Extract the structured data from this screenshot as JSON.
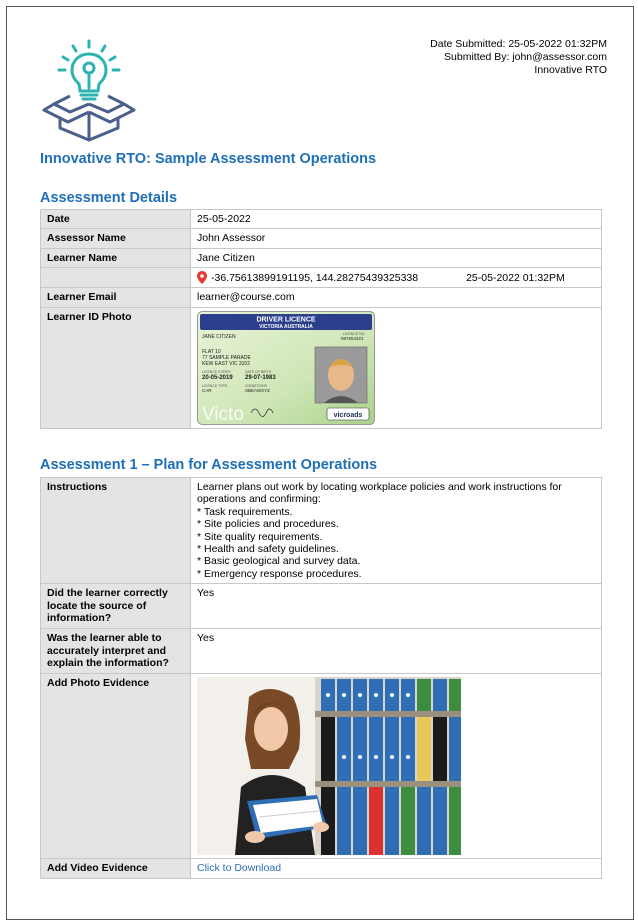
{
  "header": {
    "date_submitted": "Date Submitted: 25-05-2022 01:32PM",
    "submitted_by": "Submitted By: john@assessor.com",
    "organisation": "Innovative RTO"
  },
  "doc_title": "Innovative RTO: Sample Assessment Operations",
  "details": {
    "section_title": "Assessment Details",
    "date_label": "Date",
    "date_value": "25-05-2022",
    "assessor_label": "Assessor Name",
    "assessor_value": "John Assessor",
    "learner_label": "Learner Name",
    "learner_value": "Jane Citizen",
    "gps_coords": "-36.75613899191195, 144.28275439325338",
    "gps_time": "25-05-2022 01:32PM",
    "email_label": "Learner Email",
    "email_value": "learner@course.com",
    "id_photo_label": "Learner ID Photo"
  },
  "licence": {
    "title": "DRIVER LICENCE",
    "subtitle": "VICTORIA AUSTRALIA",
    "name": "JANE CITIZEN",
    "licence_no_label": "LICENCE NO.",
    "licence_no": "987654321",
    "address1": "FLAT 10",
    "address2": "77 SAMPLE PARADE",
    "address3": "KEW EAST VIC 3102",
    "expiry_label": "LICENCE EXPIRY",
    "expiry": "20-05-2019",
    "dob_label": "DATE OF BIRTH",
    "dob": "29-07-1983",
    "type_label": "LICENCE TYPE",
    "type": "CAR",
    "conditions_label": "CONDITIONS",
    "conditions": "SBEAWXYZ",
    "footer_left": "Victo",
    "brand": "vicroads"
  },
  "assessment1": {
    "section_title": "Assessment 1 – Plan for Assessment Operations",
    "instructions_label": "Instructions",
    "instructions_intro": "Learner plans out work by locating workplace policies and work instructions for operations and confirming:",
    "instruction_items": [
      "* Task requirements.",
      "* Site policies and procedures.",
      "* Site quality requirements.",
      "* Health and safety guidelines.",
      "* Basic geological and survey data.",
      "* Emergency response procedures."
    ],
    "q1_label": "Did the learner correctly locate the source of information?",
    "q1_value": "Yes",
    "q2_label": "Was the learner able to accurately interpret and explain the information?",
    "q2_value": "Yes",
    "photo_label": "Add Photo Evidence",
    "video_label": "Add Video Evidence",
    "video_link": "Click to Download"
  },
  "colors": {
    "heading": "#1e6fb8",
    "logo": "#2ab3b0",
    "logo_box": "#4a5f8a",
    "label_bg": "#e4e4e4",
    "pin": "#e53935",
    "link": "#2e6db4"
  }
}
